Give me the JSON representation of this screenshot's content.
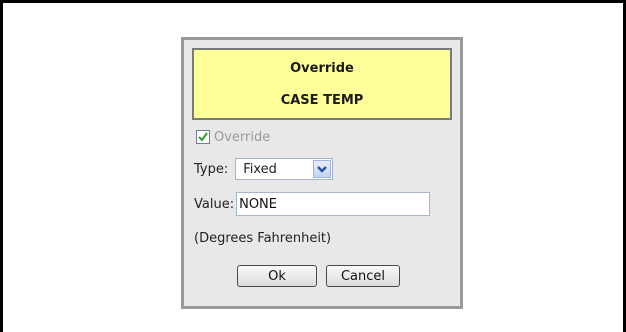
{
  "dialog": {
    "title": "Override",
    "subtitle": "CASE TEMP",
    "override_checkbox": {
      "label": "Override",
      "checked": true
    },
    "type": {
      "label": "Type:",
      "selected": "Fixed"
    },
    "value": {
      "label": "Value:",
      "current": "NONE"
    },
    "units": "(Degrees Fahrenheit)",
    "ok_label": "Ok",
    "cancel_label": "Cancel"
  },
  "colors": {
    "header_bg": "#ffff99",
    "dialog_bg": "#e8e8e8",
    "check_green": "#2e9b2e"
  },
  "icons": {
    "checkbox": "checkmark-icon",
    "dropdown": "chevron-down-icon"
  }
}
